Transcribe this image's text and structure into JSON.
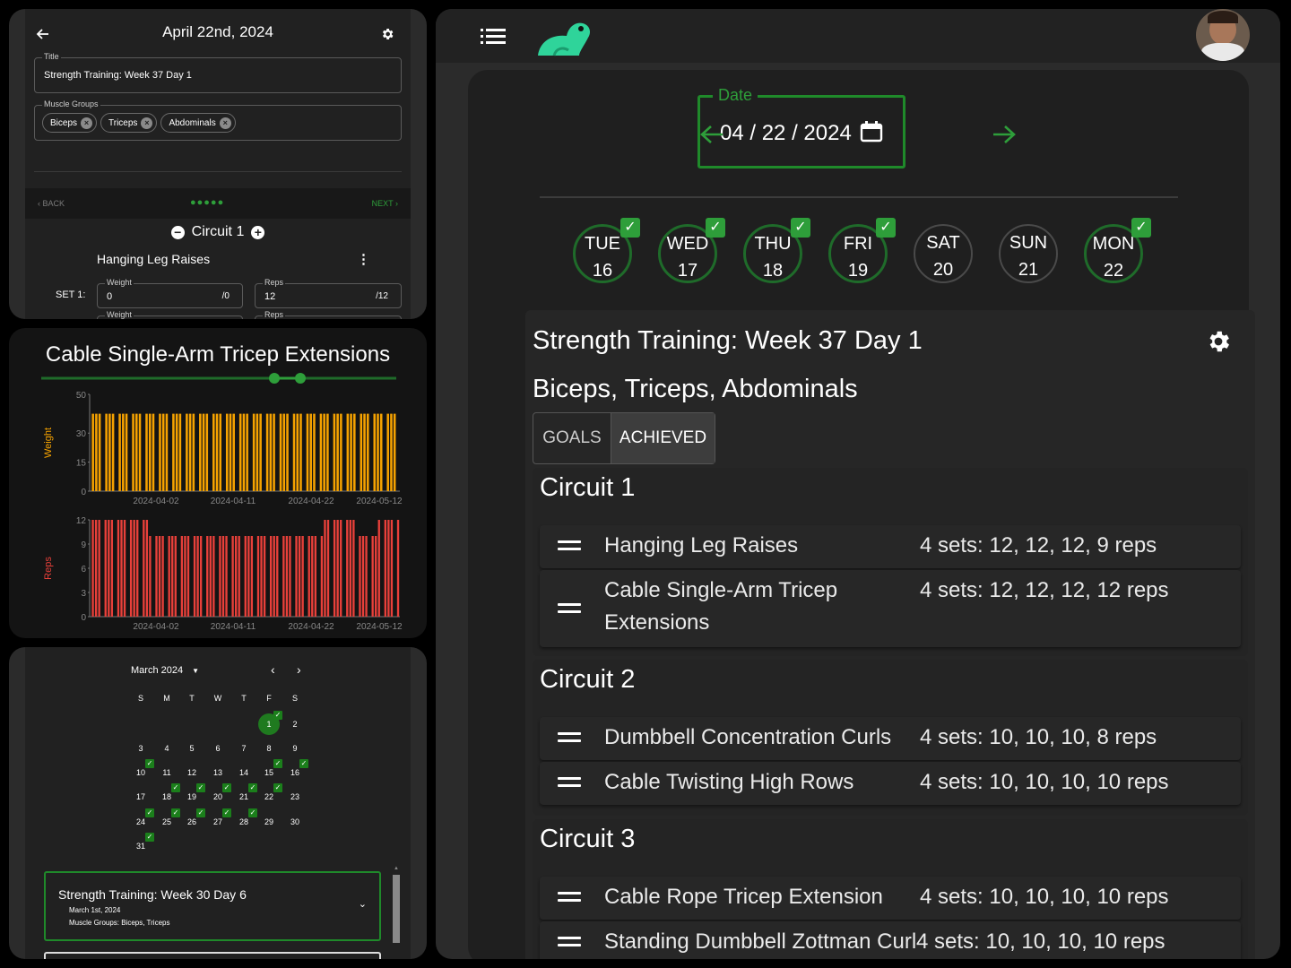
{
  "left_top": {
    "date_title": "April 22nd, 2024",
    "title_label": "Title",
    "title_value": "Strength Training: Week 37 Day 1",
    "muscle_label": "Muscle Groups",
    "chips": [
      "Biceps",
      "Triceps",
      "Abdominals"
    ],
    "back": "BACK",
    "next": "NEXT",
    "circuit": "Circuit 1",
    "exercise": "Hanging Leg Raises",
    "set_label": "SET 1:",
    "weight_label": "Weight",
    "weight_value": "0",
    "weight_goal": "/0",
    "reps_label": "Reps",
    "reps_value": "12",
    "reps_goal": "/12",
    "weight_label2": "Weight",
    "reps_label2": "Reps"
  },
  "chart_title": "Cable Single-Arm Tricep Extensions",
  "chart_data": [
    {
      "type": "bar",
      "ylabel": "Weight",
      "ylim": [
        0,
        50
      ],
      "yticks": [
        0,
        15,
        30,
        50
      ],
      "xticks": [
        "2024-04-02",
        "2024-04-11",
        "2024-04-22",
        "2024-05-12"
      ],
      "color": "#f5a200",
      "values": [
        40,
        40,
        40,
        40,
        40,
        40,
        40,
        40,
        40,
        40,
        40,
        40,
        40,
        40,
        40,
        40,
        40,
        40,
        40,
        40,
        40,
        40,
        40,
        40,
        40,
        40,
        40,
        40,
        40,
        40,
        40,
        40,
        40,
        40,
        40,
        40,
        40,
        40,
        40,
        40,
        40,
        40,
        40,
        40,
        40,
        40,
        40,
        40,
        40,
        40,
        40,
        40,
        40,
        40,
        40,
        40,
        40,
        40,
        40,
        40,
        40,
        40,
        40,
        40,
        40,
        40,
        40,
        40,
        40,
        40,
        40,
        40,
        40,
        40,
        40,
        40,
        40,
        40,
        40,
        40,
        40,
        40,
        40,
        40,
        40,
        40,
        40,
        40,
        40,
        40,
        40,
        40
      ]
    },
    {
      "type": "bar",
      "ylabel": "Reps",
      "ylim": [
        0,
        12
      ],
      "yticks": [
        0,
        3,
        6,
        9,
        12
      ],
      "xticks": [
        "2024-04-02",
        "2024-04-11",
        "2024-04-22",
        "2024-05-12"
      ],
      "color": "#e8403a",
      "values": [
        12,
        12,
        12,
        12,
        12,
        12,
        12,
        12,
        12,
        12,
        12,
        12,
        12,
        12,
        12,
        12,
        12,
        12,
        10,
        10,
        10,
        10,
        10,
        10,
        10,
        10,
        10,
        10,
        10,
        10,
        10,
        10,
        10,
        10,
        10,
        10,
        10,
        10,
        10,
        10,
        10,
        10,
        10,
        10,
        10,
        10,
        10,
        10,
        10,
        10,
        10,
        10,
        10,
        10,
        10,
        10,
        10,
        10,
        10,
        10,
        10,
        10,
        10,
        10,
        10,
        10,
        10,
        10,
        10,
        10,
        10,
        10,
        10,
        12,
        12,
        12,
        12,
        12,
        12,
        12,
        12,
        12,
        12,
        12,
        10,
        10,
        10,
        10,
        10,
        10,
        12,
        12,
        12,
        12,
        12,
        12,
        12
      ]
    }
  ],
  "calendar": {
    "month": "March 2024",
    "weekdays": [
      "S",
      "M",
      "T",
      "W",
      "T",
      "F",
      "S"
    ],
    "selected": "1",
    "weeks": [
      [
        "",
        "",
        "",
        "",
        "",
        "1",
        "2"
      ],
      [
        "3",
        "4",
        "5",
        "6",
        "7",
        "8",
        "9"
      ],
      [
        "10",
        "11",
        "12",
        "13",
        "14",
        "15",
        "16"
      ],
      [
        "17",
        "18",
        "19",
        "20",
        "21",
        "22",
        "23"
      ],
      [
        "24",
        "25",
        "26",
        "27",
        "28",
        "29",
        "30"
      ],
      [
        "31",
        "",
        "",
        "",
        "",
        "",
        ""
      ]
    ],
    "checked": [
      "1",
      "10",
      "15",
      "16",
      "18",
      "19",
      "20",
      "21",
      "22",
      "24",
      "25",
      "26",
      "27",
      "28",
      "31"
    ],
    "workout_title": "Strength Training: Week 30 Day 6",
    "workout_date": "March 1st, 2024",
    "workout_groups": "Muscle Groups: Biceps, Triceps"
  },
  "main": {
    "date_label": "Date",
    "date_value": "04 / 22 / 2024",
    "days": [
      {
        "dow": "TUE",
        "num": "16",
        "done": true
      },
      {
        "dow": "WED",
        "num": "17",
        "done": true
      },
      {
        "dow": "THU",
        "num": "18",
        "done": true
      },
      {
        "dow": "FRI",
        "num": "19",
        "done": true
      },
      {
        "dow": "SAT",
        "num": "20",
        "done": false
      },
      {
        "dow": "SUN",
        "num": "21",
        "done": false
      },
      {
        "dow": "MON",
        "num": "22",
        "done": true
      }
    ],
    "workout_title": "Strength Training: Week 37 Day 1",
    "muscle_groups": "Biceps, Triceps, Abdominals",
    "tab_goals": "GOALS",
    "tab_achieved": "ACHIEVED",
    "circuits": [
      {
        "name": "Circuit 1",
        "exercises": [
          {
            "name": "Hanging Leg Raises",
            "sets": "4 sets: 12, 12, 12, 9 reps"
          },
          {
            "name": "Cable Single-Arm Tricep Extensions",
            "sets": "4 sets: 12, 12, 12, 12 reps"
          }
        ]
      },
      {
        "name": "Circuit 2",
        "exercises": [
          {
            "name": "Dumbbell Concentration Curls",
            "sets": "4 sets: 10, 10, 10, 8 reps"
          },
          {
            "name": "Cable Twisting High Rows",
            "sets": "4 sets: 10, 10, 10, 10 reps"
          }
        ]
      },
      {
        "name": "Circuit 3",
        "exercises": [
          {
            "name": "Cable Rope Tricep Extension",
            "sets": "4 sets: 10, 10, 10, 10 reps"
          },
          {
            "name": "Standing Dumbbell Zottman Curl",
            "sets": "4 sets: 10, 10, 10, 10 reps"
          }
        ]
      }
    ]
  },
  "colors": {
    "accent_green": "#2e9e3a",
    "weight_bar": "#f5a200",
    "reps_bar": "#e8403a"
  }
}
